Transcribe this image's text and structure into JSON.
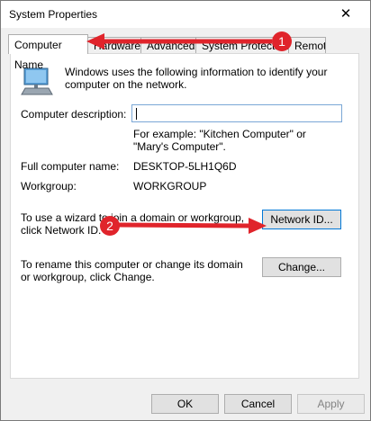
{
  "window": {
    "title": "System Properties",
    "close_glyph": "✕"
  },
  "tabs": [
    {
      "label": "Computer Name"
    },
    {
      "label": "Hardware"
    },
    {
      "label": "Advanced"
    },
    {
      "label": "System Protection"
    },
    {
      "label": "Remote"
    }
  ],
  "intro_text": "Windows uses the following information to identify your computer on the network.",
  "description": {
    "label": "Computer description:",
    "value": "",
    "hint": "For example: \"Kitchen Computer\" or \"Mary's Computer\"."
  },
  "full_name": {
    "label": "Full computer name:",
    "value": "DESKTOP-5LH1Q6D"
  },
  "workgroup": {
    "label": "Workgroup:",
    "value": "WORKGROUP"
  },
  "network_id": {
    "text": "To use a wizard to join a domain or workgroup, click Network ID.",
    "button": "Network ID..."
  },
  "change": {
    "text": "To rename this computer or change its domain or workgroup, click Change.",
    "button": "Change..."
  },
  "footer": {
    "ok": "OK",
    "cancel": "Cancel",
    "apply": "Apply"
  },
  "annotations": {
    "badge1": "1",
    "badge2": "2",
    "color": "#e0242b"
  }
}
